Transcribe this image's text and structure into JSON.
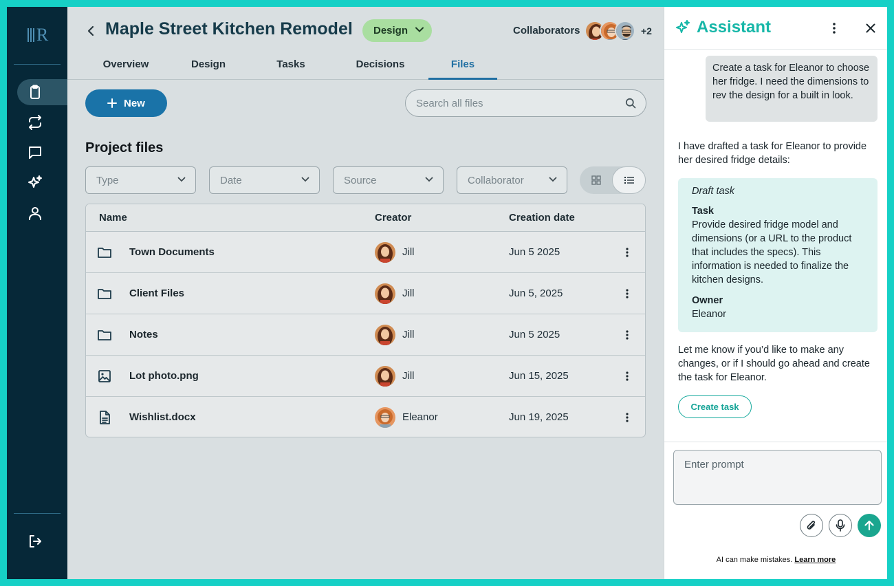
{
  "app": {
    "logo_text": "R",
    "brand_color": "#062838",
    "accent_color": "#1a73a8",
    "assistant_color": "#17b7a8"
  },
  "sidebar": {
    "items": [
      {
        "name": "projects",
        "icon": "clipboard-icon",
        "active": true
      },
      {
        "name": "updates",
        "icon": "repeat-icon",
        "active": false
      },
      {
        "name": "messages",
        "icon": "chat-icon",
        "active": false
      },
      {
        "name": "assistant",
        "icon": "sparkles-icon",
        "active": false
      },
      {
        "name": "profile",
        "icon": "user-icon",
        "active": false
      }
    ],
    "logout_icon": "logout-icon"
  },
  "header": {
    "title": "Maple Street Kitchen Remodel",
    "phase": "Design",
    "collaborators_label": "Collaborators",
    "collaborators_more": "+2"
  },
  "tabs": [
    {
      "label": "Overview",
      "active": false
    },
    {
      "label": "Design",
      "active": false
    },
    {
      "label": "Tasks",
      "active": false
    },
    {
      "label": "Decisions",
      "active": false
    },
    {
      "label": "Files",
      "active": true
    }
  ],
  "toolbar": {
    "new_label": "New",
    "search_placeholder": "Search all files"
  },
  "files": {
    "section_title": "Project files",
    "filters": [
      "Type",
      "Date",
      "Source",
      "Collaborator"
    ],
    "view_mode": "list",
    "columns": [
      "Name",
      "Creator",
      "Creation date"
    ],
    "rows": [
      {
        "icon": "folder-icon",
        "name": "Town Documents",
        "creator": "Jill",
        "date": "Jun 5 2025"
      },
      {
        "icon": "folder-icon",
        "name": "Client Files",
        "creator": "Jill",
        "date": "Jun 5, 2025"
      },
      {
        "icon": "folder-icon",
        "name": "Notes",
        "creator": "Jill",
        "date": "Jun 5 2025"
      },
      {
        "icon": "image-file-icon",
        "name": "Lot photo.png",
        "creator": "Jill",
        "date": "Jun 15, 2025"
      },
      {
        "icon": "document-icon",
        "name": "Wishlist.docx",
        "creator": "Eleanor",
        "date": "Jun 19, 2025"
      }
    ]
  },
  "assistant": {
    "title": "Assistant",
    "user_message": "Create a task for Eleanor  to choose her fridge. I need the dimensions to rev the design for a built in look.",
    "reply_intro": "I have drafted a task for Eleanor to provide her desired fridge details:",
    "draft": {
      "label": "Draft task",
      "task_heading": "Task",
      "task_text": "Provide desired fridge model and dimensions (or a URL to the product that includes the specs). This information is needed to finalize the kitchen designs.",
      "owner_heading": "Owner",
      "owner_name": "Eleanor"
    },
    "reply_followup": "Let me know if you’d like to make any changes, or if I should go ahead and create the task for Eleanor.",
    "create_task_label": "Create task",
    "prompt_placeholder": "Enter prompt",
    "disclaimer": "AI can make mistakes.",
    "learn_more": "Learn more"
  }
}
